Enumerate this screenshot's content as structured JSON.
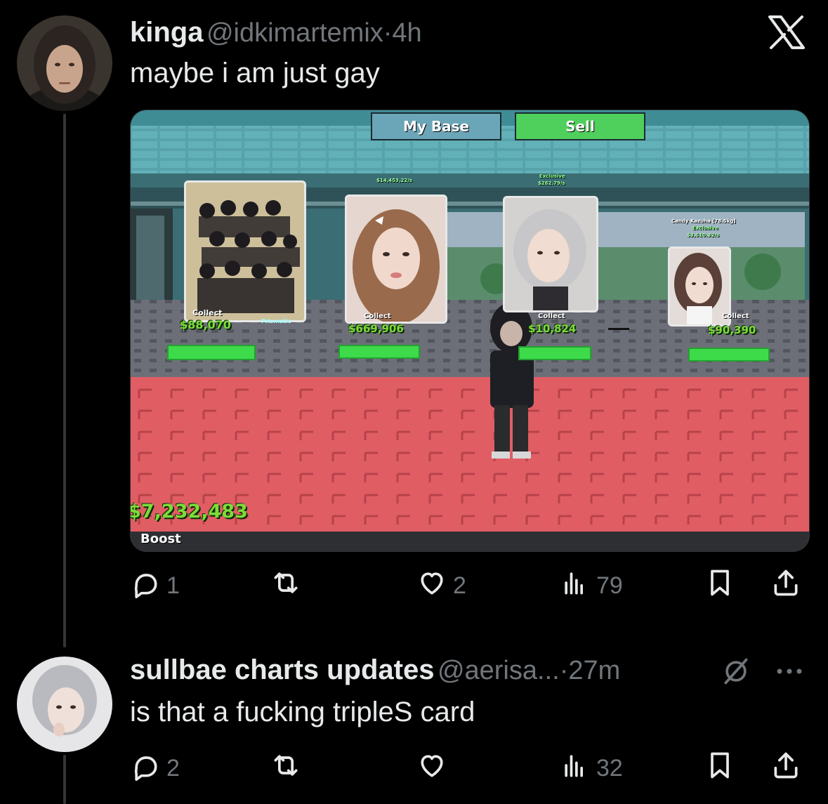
{
  "post1": {
    "display_name": "kinga",
    "handle": "@idkimartemix",
    "separator": "·",
    "time": "4h",
    "text": "maybe i am just gay",
    "stats": {
      "replies": "1",
      "likes": "2",
      "views": "79"
    }
  },
  "game": {
    "buttons": {
      "my_base": "My Base",
      "sell": "Sell"
    },
    "collect_label": "Collect",
    "cards": [
      {
        "amount": "$88,070",
        "tag": "Prismatic"
      },
      {
        "amount": "$669,906",
        "rate": "$14,453,22/s"
      },
      {
        "amount": "$10,824",
        "rate": "$262.79/s",
        "tag": "Exclusive"
      },
      {
        "amount": "$90,390",
        "title": "Candy Kazuha [78.5kg]",
        "tag": "Exclusive",
        "rate": "$3,510.32/s"
      }
    ],
    "money": "7,232,483",
    "boost": "Boost"
  },
  "post2": {
    "display_name": "sullbae charts updates",
    "handle": "@aerisa...",
    "separator": "·",
    "time": "27m",
    "text": "is that a fucking tripleS card",
    "stats": {
      "replies": "2",
      "likes": "",
      "views": "32"
    }
  },
  "icons": [
    "x-logo-icon",
    "reply-icon",
    "repost-icon",
    "like-icon",
    "views-icon",
    "bookmark-icon",
    "share-icon",
    "grok-icon",
    "more-icon"
  ]
}
